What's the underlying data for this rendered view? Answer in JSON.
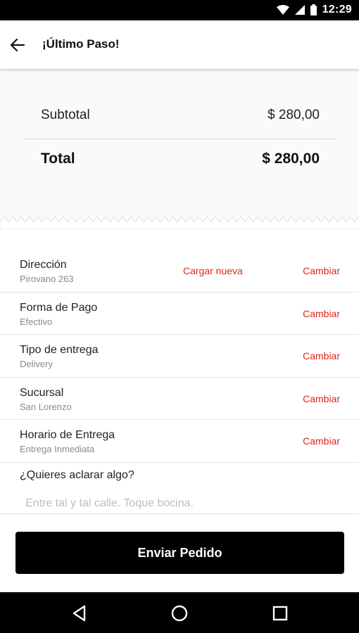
{
  "status_bar": {
    "time": "12:29",
    "icons": [
      "wifi-icon",
      "signal-icon",
      "battery-icon"
    ]
  },
  "app_bar": {
    "title": "¡Último Paso!",
    "back_icon": "arrow-left-icon"
  },
  "summary": {
    "subtotal_label": "Subtotal",
    "subtotal_value": "$ 280,00",
    "total_label": "Total",
    "total_value": "$ 280,00"
  },
  "details": [
    {
      "label": "Dirección",
      "value": "Pirovano 263",
      "secondary_action": "Cargar nueva",
      "action": "Cambiar"
    },
    {
      "label": "Forma de Pago",
      "value": "Efectivo",
      "action": "Cambiar"
    },
    {
      "label": "Tipo de entrega",
      "value": "Delivery",
      "action": "Cambiar"
    },
    {
      "label": "Sucursal",
      "value": "San Lorenzo",
      "action": "Cambiar"
    },
    {
      "label": "Horario de Entrega",
      "value": "Entrega Inmediata",
      "action": "Cambiar"
    }
  ],
  "note": {
    "question": "¿Quieres aclarar algo?",
    "value": "",
    "placeholder": "Entre tal y tal calle. Toque bocina."
  },
  "submit_label": "Enviar Pedido",
  "nav_bar": {
    "icons": [
      "back-triangle-icon",
      "home-circle-icon",
      "recents-square-icon"
    ]
  },
  "colors": {
    "accent": "#e0241b",
    "button": "#000000",
    "status_bar": "#000000"
  }
}
